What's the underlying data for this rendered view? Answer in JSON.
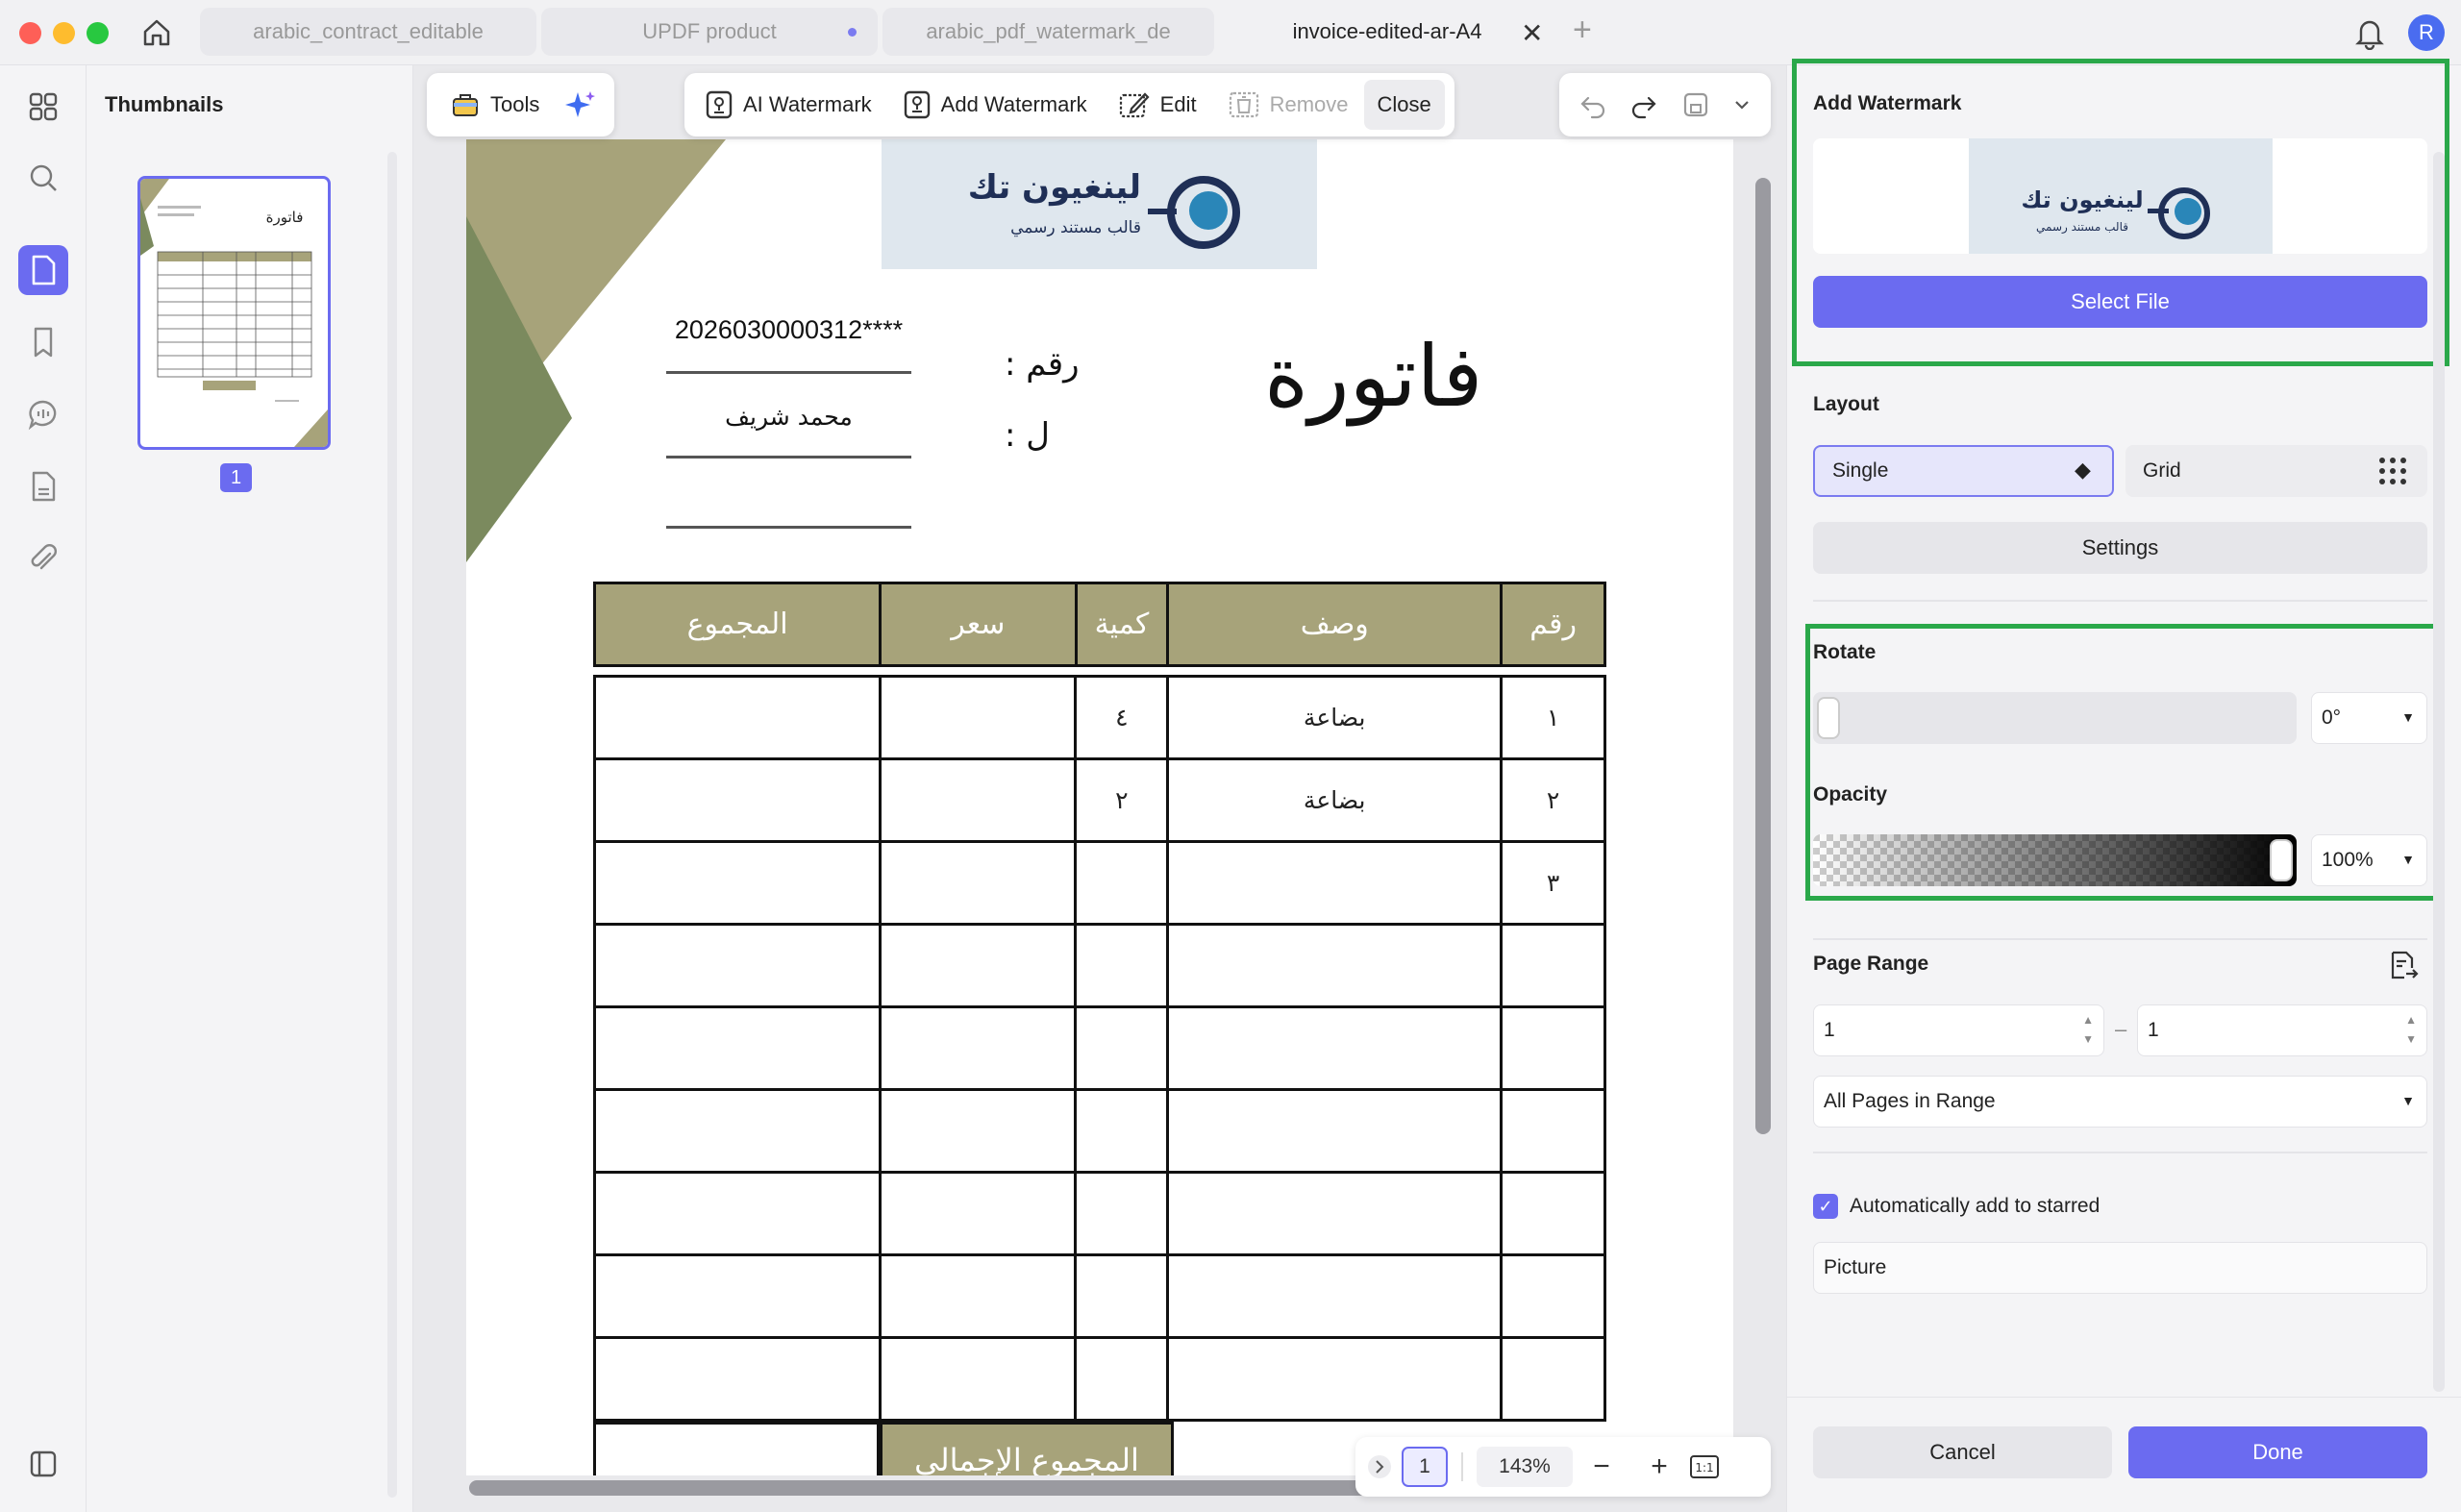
{
  "tabs": [
    {
      "label": "arabic_contract_editable"
    },
    {
      "label": "UPDF product"
    },
    {
      "label": "arabic_pdf_watermark_de"
    },
    {
      "label": "invoice-edited-ar-A4"
    }
  ],
  "avatar": {
    "initial": "R"
  },
  "thumbnails": {
    "title": "Thumbnails",
    "page_badge": "1"
  },
  "toolbar": {
    "tools": "Tools",
    "ai_watermark": "AI Watermark",
    "add_watermark": "Add Watermark",
    "edit": "Edit",
    "remove": "Remove",
    "close": "Close"
  },
  "document": {
    "logo_name": "لينغيون تك",
    "logo_tagline": "قالب مستند رسمي",
    "title": "فاتورة",
    "number_label": "رقم :",
    "number_value": "2026030000312****",
    "to_label": "ل :",
    "to_value": "محمد شريف",
    "table_headers": [
      "المجموع",
      "سعر",
      "كمية",
      "وصف",
      "رقم"
    ],
    "rows": [
      [
        "",
        "",
        "٤",
        "بضاعة",
        "١"
      ],
      [
        "",
        "",
        "٢",
        "بضاعة",
        "٢"
      ],
      [
        "",
        "",
        "",
        "",
        "٣"
      ],
      [
        "",
        "",
        "",
        "",
        ""
      ],
      [
        "",
        "",
        "",
        "",
        ""
      ],
      [
        "",
        "",
        "",
        "",
        ""
      ],
      [
        "",
        "",
        "",
        "",
        ""
      ],
      [
        "",
        "",
        "",
        "",
        ""
      ],
      [
        "",
        "",
        "",
        "",
        ""
      ]
    ],
    "grand_total_label": "المجموع الإجمالي"
  },
  "bottom_bar": {
    "page": "1",
    "zoom": "143%"
  },
  "panel": {
    "add_watermark_title": "Add Watermark",
    "select_file": "Select File",
    "layout_title": "Layout",
    "layout_single": "Single",
    "layout_grid": "Grid",
    "settings": "Settings",
    "rotate_title": "Rotate",
    "rotate_value": "0°",
    "opacity_title": "Opacity",
    "opacity_value": "100%",
    "opacity_level": 1.0,
    "page_range_title": "Page Range",
    "range_from": "1",
    "range_to": "1",
    "range_mode": "All Pages in Range",
    "auto_starred": "Automatically add to starred",
    "starred_value": "Picture",
    "cancel": "Cancel",
    "done": "Done"
  },
  "colors": {
    "accent": "#6b6bf0",
    "highlight": "#2aa84a",
    "olive": "#a7a37a",
    "olive_dark": "#7b8a5e"
  }
}
